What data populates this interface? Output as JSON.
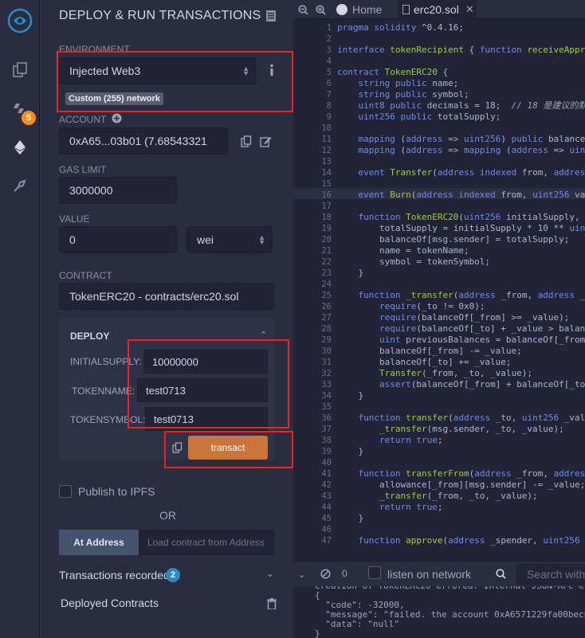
{
  "panel": {
    "title": "DEPLOY & RUN TRANSACTIONS",
    "environment": {
      "label": "ENVIRONMENT",
      "value": "Injected Web3",
      "network_badge": "Custom (255) network"
    },
    "account": {
      "label": "ACCOUNT",
      "value": "0xA65...03b01 (7.68543321"
    },
    "gas_limit": {
      "label": "GAS LIMIT",
      "value": "3000000"
    },
    "value": {
      "label": "VALUE",
      "amount": "0",
      "unit": "wei"
    },
    "contract": {
      "label": "CONTRACT",
      "value": "TokenERC20 - contracts/erc20.sol"
    },
    "deploy": {
      "title": "DEPLOY",
      "params": [
        {
          "label": "INITIALSUPPLY:",
          "value": "10000000"
        },
        {
          "label": "TOKENNAME:",
          "value": "test0713"
        },
        {
          "label": "TOKENSYMBOL:",
          "value": "test0713"
        }
      ],
      "transact_label": "transact"
    },
    "publish_ipfs": "Publish to IPFS",
    "or": "OR",
    "at_address": {
      "button": "At Address",
      "placeholder": "Load contract from Address"
    },
    "transactions_recorded": {
      "label": "Transactions recorded",
      "count": "2"
    },
    "deployed_contracts": "Deployed Contracts"
  },
  "rail": {
    "plugin_badge": "5"
  },
  "tabs": {
    "home": "Home",
    "file": "erc20.sol"
  },
  "editor": {
    "line_numbers": [
      "1",
      "2",
      "3",
      "4",
      "5",
      "6",
      "7",
      "8",
      "9",
      "10",
      "11",
      "12",
      "13",
      "14",
      "15",
      "16",
      "17",
      "18",
      "19",
      "20",
      "21",
      "22",
      "23",
      "24",
      "25",
      "26",
      "27",
      "28",
      "29",
      "30",
      "31",
      "32",
      "33",
      "34",
      "35",
      "36",
      "37",
      "38",
      "39",
      "40",
      "41",
      "42",
      "43",
      "44",
      "45",
      "46",
      "47"
    ],
    "lines": [
      "pragma solidity ^0.4.16;",
      "",
      "interface tokenRecipient { function receiveApproval",
      "",
      "contract TokenERC20 {",
      "    string public name;",
      "    string public symbol;",
      "    uint8 public decimals = 18;  // 18 是建议的默认值",
      "    uint256 public totalSupply;",
      "",
      "    mapping (address => uint256) public balanceOf;",
      "    mapping (address => mapping (address => uint256)",
      "",
      "    event Transfer(address indexed from, address inde",
      "",
      "    event Burn(address indexed from, uint256 value);",
      "",
      "    function TokenERC20(uint256 initialSupply, string",
      "        totalSupply = initialSupply * 10 ** uint256(",
      "        balanceOf[msg.sender] = totalSupply;",
      "        name = tokenName;",
      "        symbol = tokenSymbol;",
      "    }",
      "",
      "    function _transfer(address _from, address _to, ui",
      "        require(_to != 0x0);",
      "        require(balanceOf[_from] >= _value);",
      "        require(balanceOf[_to] + _value > balanceOf[_",
      "        uint previousBalances = balanceOf[_from] + ba",
      "        balanceOf[_from] -= _value;",
      "        balanceOf[_to] += _value;",
      "        Transfer(_from, _to, _value);",
      "        assert(balanceOf[_from] + balanceOf[_to] == p",
      "    }",
      "",
      "    function transfer(address _to, uint256 _value) p",
      "        _transfer(msg.sender, _to, _value);",
      "        return true;",
      "    }",
      "",
      "    function transferFrom(address _from, address _to,",
      "        allowance[_from][msg.sender] -= _value;",
      "        _transfer(_from, _to, _value);",
      "        return true;",
      "    }",
      "",
      "    function approve(address _spender, uint256 _value"
    ]
  },
  "terminal": {
    "count": "0",
    "listen_label": "listen on network",
    "search_placeholder": "Search with",
    "lines": [
      "creation of TokenERC20 errored: Internal JSON-RPC error.",
      "{",
      "  \"code\": -32000,",
      "  \"message\": \"failed. the account 0xA6571229fa00becb",
      "  \"data\": \"null\"",
      "}"
    ]
  },
  "colors": {
    "accent": "#c97539",
    "highlight_border": "#e8252b",
    "badge": "#2a8ac1"
  }
}
